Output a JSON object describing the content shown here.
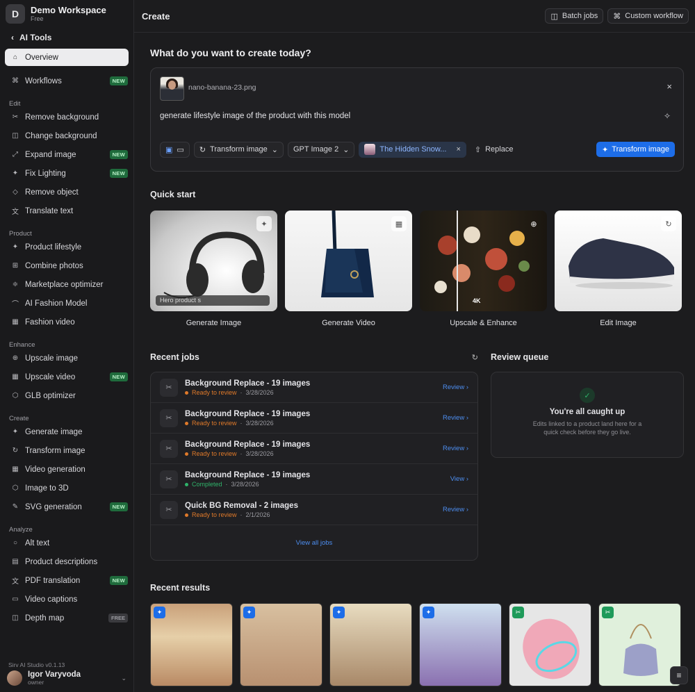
{
  "workspace": {
    "initial": "D",
    "name": "Demo Workspace",
    "plan": "Free"
  },
  "sidebar": {
    "back_label": "AI Tools",
    "top": [
      {
        "label": "Overview",
        "icon": "home-icon",
        "active": true
      },
      {
        "label": "Workflows",
        "icon": "workflow-icon",
        "badge": "NEW"
      }
    ],
    "sections": [
      {
        "title": "Edit",
        "items": [
          {
            "label": "Remove background",
            "icon": "scissors-icon"
          },
          {
            "label": "Change background",
            "icon": "layers-icon"
          },
          {
            "label": "Expand image",
            "icon": "expand-icon",
            "badge": "NEW"
          },
          {
            "label": "Fix Lighting",
            "icon": "sparkle-icon",
            "badge": "NEW"
          },
          {
            "label": "Remove object",
            "icon": "eraser-icon"
          },
          {
            "label": "Translate text",
            "icon": "translate-icon"
          }
        ]
      },
      {
        "title": "Product",
        "items": [
          {
            "label": "Product lifestyle",
            "icon": "sparkle-icon"
          },
          {
            "label": "Combine photos",
            "icon": "grid-icon"
          },
          {
            "label": "Marketplace optimizer",
            "icon": "sliders-icon"
          },
          {
            "label": "AI Fashion Model",
            "icon": "hanger-icon"
          },
          {
            "label": "Fashion video",
            "icon": "film-icon"
          }
        ]
      },
      {
        "title": "Enhance",
        "items": [
          {
            "label": "Upscale image",
            "icon": "zoom-icon"
          },
          {
            "label": "Upscale video",
            "icon": "film-icon",
            "badge": "NEW"
          },
          {
            "label": "GLB optimizer",
            "icon": "cube-icon"
          }
        ]
      },
      {
        "title": "Create",
        "items": [
          {
            "label": "Generate image",
            "icon": "sparkle-icon"
          },
          {
            "label": "Transform image",
            "icon": "refresh-icon"
          },
          {
            "label": "Video generation",
            "icon": "film-icon"
          },
          {
            "label": "Image to 3D",
            "icon": "cube-icon"
          },
          {
            "label": "SVG generation",
            "icon": "pen-icon",
            "badge": "NEW"
          }
        ]
      },
      {
        "title": "Analyze",
        "items": [
          {
            "label": "Alt text",
            "icon": "chat-icon"
          },
          {
            "label": "Product descriptions",
            "icon": "document-icon"
          },
          {
            "label": "PDF translation",
            "icon": "translate-icon",
            "badge": "NEW"
          },
          {
            "label": "Video captions",
            "icon": "captions-icon"
          },
          {
            "label": "Depth map",
            "icon": "layers-icon",
            "badge": "FREE"
          }
        ]
      }
    ],
    "version": "Sirv AI Studio v0.1.13",
    "user": {
      "name": "Igor Varyvoda",
      "role": "owner"
    }
  },
  "topbar": {
    "title": "Create",
    "batch_label": "Batch jobs",
    "custom_label": "Custom workflow"
  },
  "create": {
    "heading": "What do you want to create today?",
    "file_name": "nano-banana-23.png",
    "prompt": "generate lifestyle image of the product with this model",
    "mode": "Transform image",
    "model": "GPT Image 2",
    "reference": "The Hidden Snow...",
    "replace_label": "Replace",
    "submit_label": "Transform image"
  },
  "quick_start": {
    "title": "Quick start",
    "hero_placeholder": "Hero product s",
    "upscale_tag": "4K",
    "cards": [
      {
        "label": "Generate Image"
      },
      {
        "label": "Generate Video"
      },
      {
        "label": "Upscale & Enhance"
      },
      {
        "label": "Edit Image"
      }
    ]
  },
  "recent_jobs": {
    "title": "Recent jobs",
    "view_all": "View all jobs",
    "items": [
      {
        "title": "Background Replace - 19 images",
        "status": "Ready to review",
        "date": "3/28/2026",
        "action": "Review",
        "status_color": "#e07a2a"
      },
      {
        "title": "Background Replace - 19 images",
        "status": "Ready to review",
        "date": "3/28/2026",
        "action": "Review",
        "status_color": "#e07a2a"
      },
      {
        "title": "Background Replace - 19 images",
        "status": "Ready to review",
        "date": "3/28/2026",
        "action": "Review",
        "status_color": "#e07a2a"
      },
      {
        "title": "Background Replace - 19 images",
        "status": "Completed",
        "date": "3/28/2026",
        "action": "View",
        "status_color": "#2fb36a"
      },
      {
        "title": "Quick BG Removal - 2 images",
        "status": "Ready to review",
        "date": "2/1/2026",
        "action": "Review",
        "status_color": "#e07a2a"
      }
    ]
  },
  "review_queue": {
    "title": "Review queue",
    "empty_title": "You're all caught up",
    "empty_text": "Edits linked to a product land here for a quick check before they go live."
  },
  "recent_results": {
    "title": "Recent results"
  },
  "colors": {
    "accent": "#1d6de8",
    "new_badge": "#1f6b3c",
    "ready": "#e07a2a",
    "completed": "#2fb36a"
  }
}
